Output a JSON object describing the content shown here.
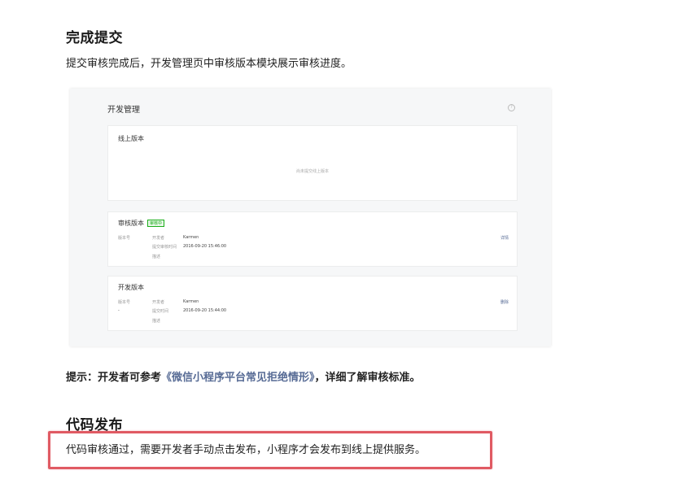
{
  "section1": {
    "heading": "完成提交",
    "text": "提交审核完成后，开发管理页中审核版本模块展示审核进度。"
  },
  "screenshot": {
    "title": "开发管理",
    "help_icon": "question-circle-icon",
    "online": {
      "title": "线上版本",
      "empty": "尚未提交线上版本"
    },
    "review": {
      "title": "审核版本",
      "badge": "审核中",
      "col_version": "版本号",
      "row1_label": "开发者",
      "row1_value": "Karmen",
      "row2_label": "提交审核时间",
      "row2_value": "2016-09-20 15:46:00",
      "row3_label": "描述",
      "action": "详情"
    },
    "dev": {
      "title": "开发版本",
      "col_version": "版本号",
      "version_value": "-",
      "row1_label": "开发者",
      "row1_value": "Karmen",
      "row2_label": "提交时间",
      "row2_value": "2016-09-20 15:44:00",
      "row3_label": "描述",
      "action": "删除"
    }
  },
  "tip": {
    "prefix": "提示：开发者可参考",
    "link": "《微信小程序平台常见拒绝情形》",
    "suffix": "，详细了解审核标准。"
  },
  "section2": {
    "heading": "代码发布",
    "text": "代码审核通过，需要开发者手动点击发布，小程序才会发布到线上提供服务。"
  },
  "colors": {
    "link": "#576b95",
    "highlight": "#e05a63",
    "badge": "#1aad19"
  }
}
